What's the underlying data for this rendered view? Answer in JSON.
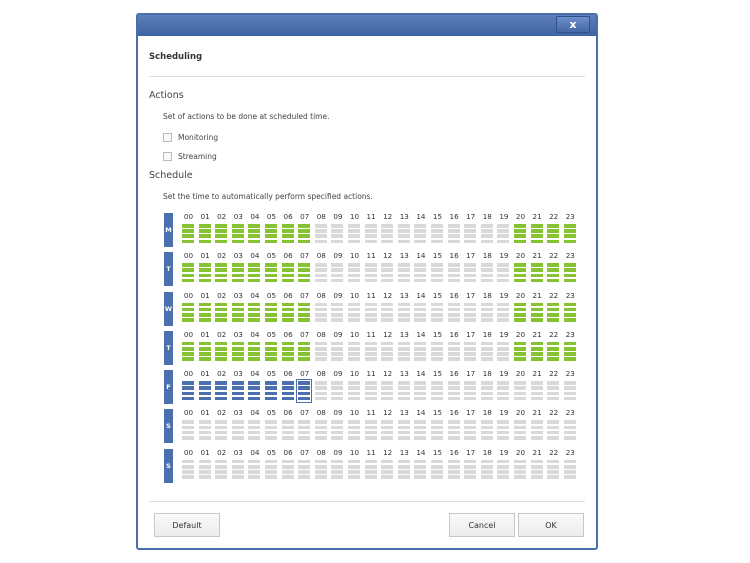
{
  "dialog": {
    "close_label": "x",
    "title": "Scheduling"
  },
  "actions": {
    "heading": "Actions",
    "description": "Set of actions to be done at scheduled time.",
    "options": [
      {
        "label": "Monitoring",
        "checked": false
      },
      {
        "label": "Streaming",
        "checked": false
      }
    ]
  },
  "schedule": {
    "heading": "Schedule",
    "description": "Set the time to automatically perform specified actions.",
    "hours": [
      "00",
      "01",
      "02",
      "03",
      "04",
      "05",
      "06",
      "07",
      "08",
      "09",
      "10",
      "11",
      "12",
      "13",
      "14",
      "15",
      "16",
      "17",
      "18",
      "19",
      "20",
      "21",
      "22",
      "23"
    ],
    "active_color": "#86c232",
    "selected_color": "#4c6fad",
    "inactive_color": "#d9d9d9",
    "days": [
      {
        "label": "M",
        "active_hours": [
          0,
          1,
          2,
          3,
          4,
          5,
          6,
          7,
          20,
          21,
          22,
          23
        ],
        "state": "active"
      },
      {
        "label": "T",
        "active_hours": [
          0,
          1,
          2,
          3,
          4,
          5,
          6,
          7,
          20,
          21,
          22,
          23
        ],
        "state": "active"
      },
      {
        "label": "W",
        "active_hours": [
          0,
          1,
          2,
          3,
          4,
          5,
          6,
          7,
          20,
          21,
          22,
          23
        ],
        "state": "active"
      },
      {
        "label": "T",
        "active_hours": [
          0,
          1,
          2,
          3,
          4,
          5,
          6,
          7,
          20,
          21,
          22,
          23
        ],
        "state": "active"
      },
      {
        "label": "F",
        "active_hours": [
          0,
          1,
          2,
          3,
          4,
          5,
          6,
          7
        ],
        "state": "selected",
        "focused_hour": 7
      },
      {
        "label": "S",
        "active_hours": [],
        "state": "active"
      },
      {
        "label": "S",
        "active_hours": [],
        "state": "active"
      }
    ]
  },
  "buttons": {
    "default": "Default",
    "cancel": "Cancel",
    "ok": "OK"
  }
}
